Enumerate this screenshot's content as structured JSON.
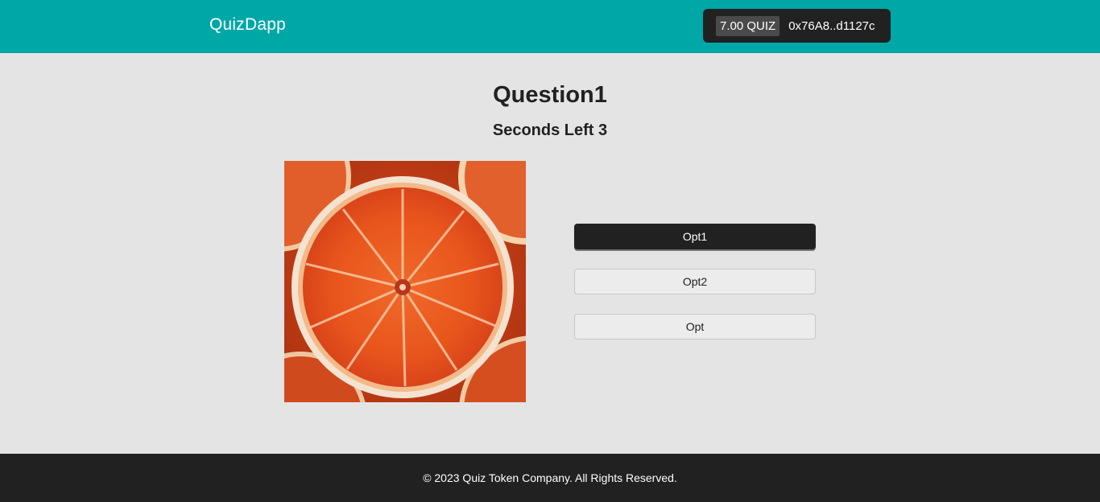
{
  "header": {
    "brand": "QuizDapp",
    "wallet": {
      "balance": "7.00 QUIZ",
      "address": "0x76A8..d1127c"
    }
  },
  "quiz": {
    "title": "Question1",
    "timer": "Seconds Left 3",
    "image": "orange-slice-photo",
    "options": [
      {
        "label": "Opt1",
        "selected": true
      },
      {
        "label": "Opt2",
        "selected": false
      },
      {
        "label": "Opt",
        "selected": false
      }
    ]
  },
  "footer": {
    "copyright": "© 2023 Quiz Token Company. All Rights Reserved."
  },
  "colors": {
    "navbar": "#00a7a7",
    "dark": "#212121",
    "page_bg": "#e4e4e4"
  }
}
